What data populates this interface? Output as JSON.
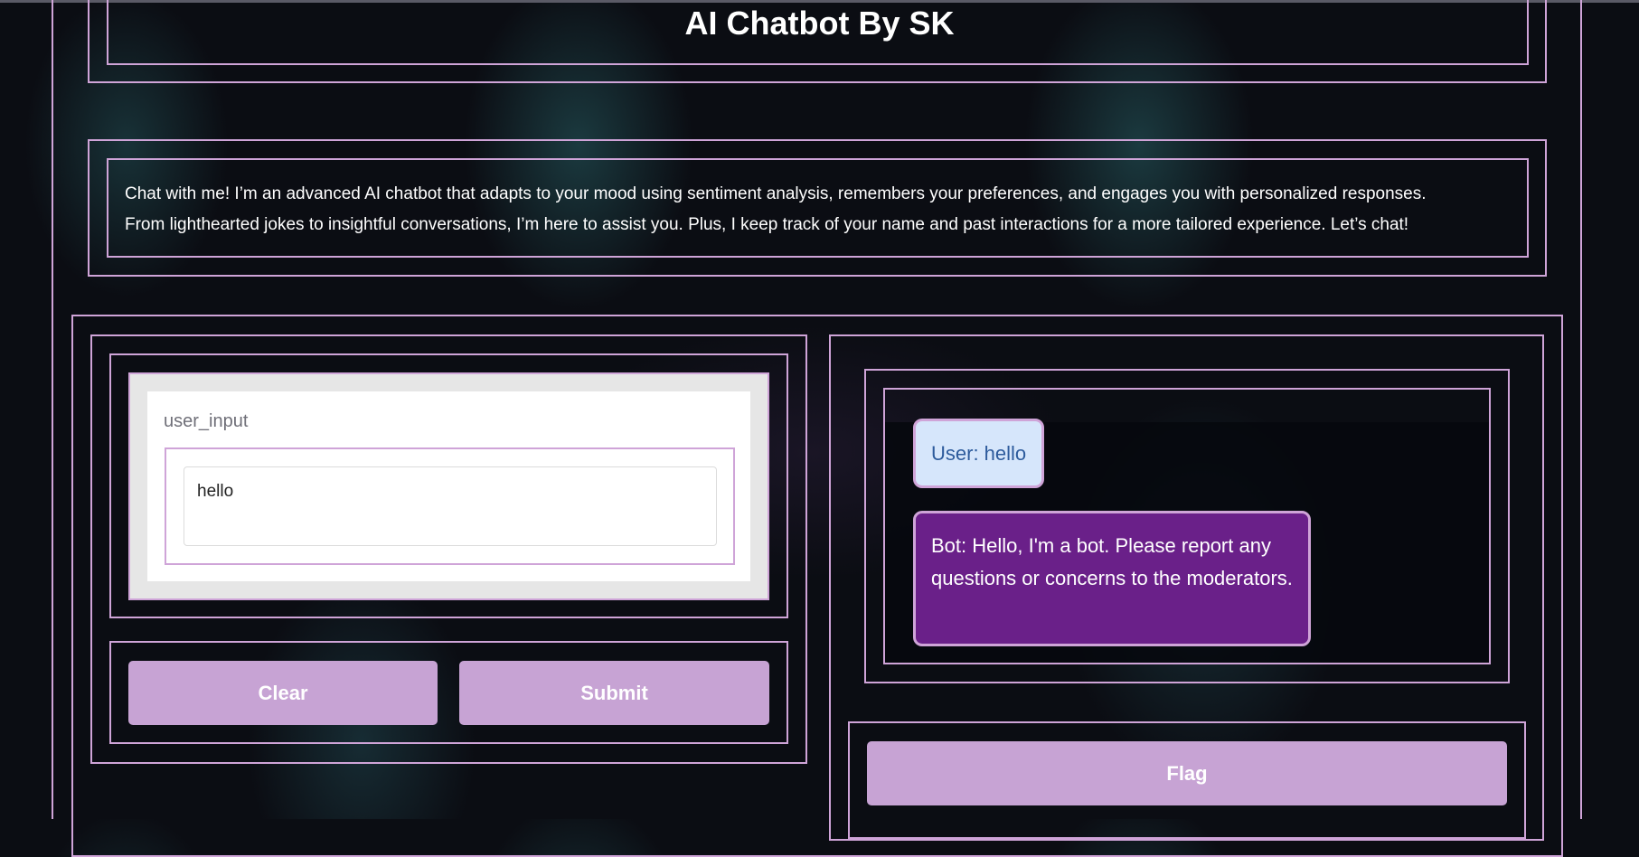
{
  "app": {
    "title": "AI Chatbot By SK",
    "description": [
      "Chat with me! I’m an advanced AI chatbot that adapts to your mood using sentiment analysis, remembers your preferences, and engages you with personalized responses.",
      "From lighthearted jokes to insightful conversations, I’m here to assist you. Plus, I keep track of your name and past interactions for a more tailored experience. Let’s chat!"
    ]
  },
  "input": {
    "label": "user_input",
    "value": "hello"
  },
  "buttons": {
    "clear": "Clear",
    "submit": "Submit",
    "flag": "Flag"
  },
  "chat": {
    "messages": [
      {
        "role": "user",
        "text": "User: hello"
      },
      {
        "role": "bot",
        "text": "Bot: Hello, I'm a bot. Please report any questions or concerns to the moderators."
      }
    ]
  },
  "colors": {
    "accent_border": "#cfa4d8",
    "button_bg": "#c7a3d4",
    "user_bubble_bg": "#d6e6fb",
    "bot_bubble_bg": "#6a2089",
    "page_bg": "#0b0d13"
  }
}
